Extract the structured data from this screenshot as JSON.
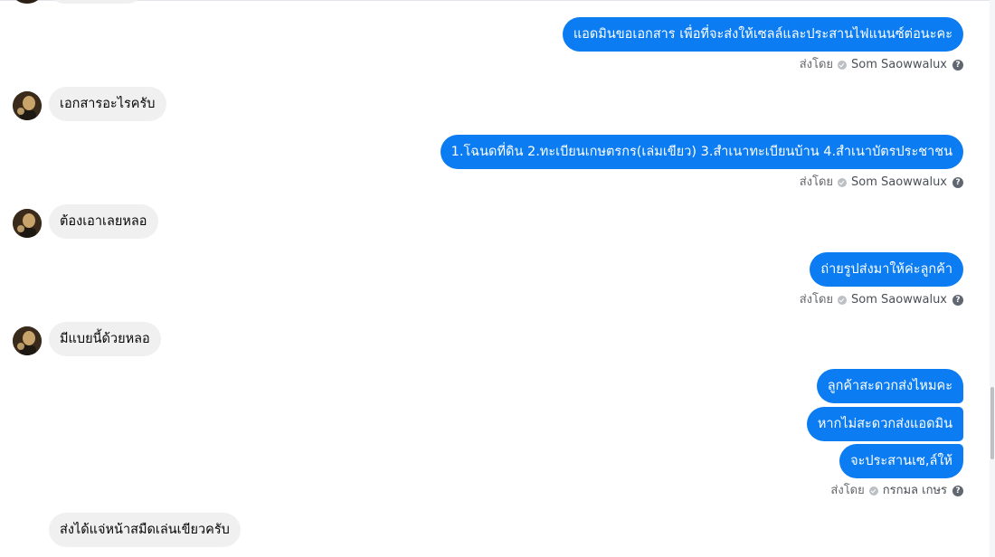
{
  "messages": [
    {
      "text": "แอดมินขอเอกสาร เพื่อที่จะส่งให้เซลล์และประสานไฟแนนซ์ต่อนะคะ"
    },
    {
      "text": "เอกสารอะไรครับ"
    },
    {
      "text": "1.โฉนดที่ดิน 2.ทะเบียนเกษตรกร(เล่มเขียว) 3.สำเนาทะเบียนบ้าน 4.สำเนาบัตรประชาชน"
    },
    {
      "text": "ต้องเอาเลยหลอ"
    },
    {
      "text": "ถ่ายรูปส่งมาให้ค่ะลูกค้า"
    },
    {
      "text": "มีแบยนี้ด้วยหลอ"
    },
    {
      "text": "ลูกค้าสะดวกส่งไหมคะ"
    },
    {
      "text": "หากไม่สะดวกส่งแอดมิน"
    },
    {
      "text": "จะประสานเซ,ล์ให้"
    },
    {
      "text": "ส่งได้แจ่หน้าสมืดเล่นเขียวครับ"
    }
  ],
  "meta": [
    {
      "prefix": "ส่งโดย",
      "sender": "Som Saowwalux"
    },
    {
      "prefix": "ส่งโดย",
      "sender": "Som Saowwalux"
    },
    {
      "prefix": "ส่งโดย",
      "sender": "Som Saowwalux"
    },
    {
      "prefix": "ส่งโดย",
      "sender": "กรกมล เกษร"
    }
  ],
  "icons": {
    "help": "?",
    "verified": "check-circle-icon",
    "avatar": "customer-avatar"
  },
  "colors": {
    "outgoing_bubble": "#0b7cf2",
    "incoming_bubble": "#f0f0f0",
    "meta_text": "#65676b"
  }
}
